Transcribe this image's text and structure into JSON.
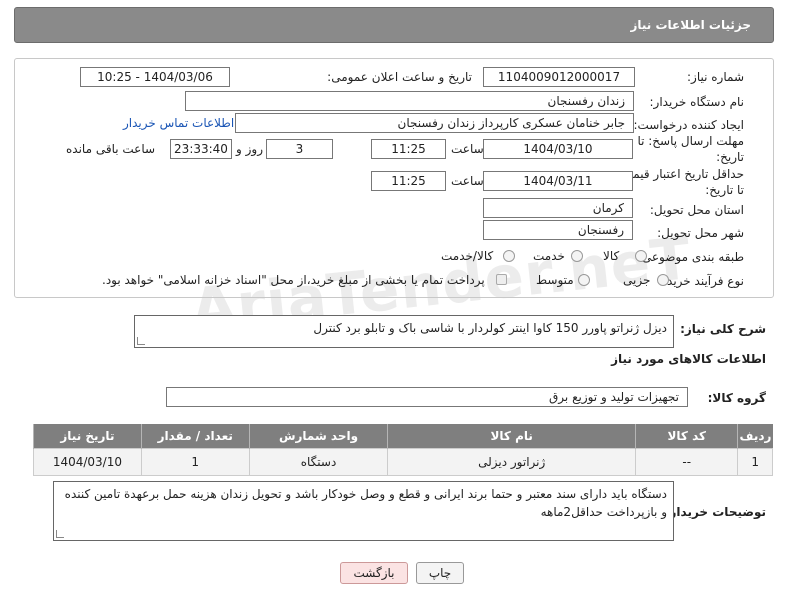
{
  "header": {
    "title": "جزئیات اطلاعات نیاز"
  },
  "form": {
    "need_number": {
      "label": "شماره نیاز:",
      "value": "1104009012000017"
    },
    "announce_datetime": {
      "label": "تاریخ و ساعت اعلان عمومی:",
      "value": "1404/03/06 - 10:25"
    },
    "buyer_org": {
      "label": "نام دستگاه خریدار:",
      "value": "زندان رفسنجان"
    },
    "requester": {
      "label": "ایجاد کننده درخواست:",
      "value": "جابر خنامان عسکری کارپرداز زندان رفسنجان",
      "contact_link": "اطلاعات تماس خریدار"
    },
    "reply_deadline": {
      "label_line1": "مهلت ارسال پاسخ: تا",
      "label_line2": "تاریخ:",
      "date": "1404/03/10",
      "time_label": "ساعت",
      "time": "11:25",
      "days": "3",
      "days_label": "روز و",
      "remaining": "23:33:40",
      "remaining_label": "ساعت باقی مانده"
    },
    "price_validity": {
      "label_line1": "حداقل تاریخ اعتبار قیمت:",
      "label_line2": "تا تاریخ:",
      "date": "1404/03/11",
      "time_label": "ساعت",
      "time": "11:25"
    },
    "province": {
      "label": "استان محل تحویل:",
      "value": "کرمان"
    },
    "city": {
      "label": "شهر محل تحویل:",
      "value": "رفسنجان"
    },
    "category": {
      "label": "طبقه بندی موضوعی:",
      "options": [
        "کالا",
        "خدمت",
        "کالا/خدمت"
      ]
    },
    "process": {
      "label": "نوع فرآیند خرید :",
      "options": [
        "جزیی",
        "متوسط"
      ],
      "note": "پرداخت تمام یا بخشی از مبلغ خرید،از محل \"اسناد خزانه اسلامی\" خواهد بود."
    }
  },
  "description": {
    "label": "شرح کلی نیاز:",
    "value": "دیزل ژنراتو پاورر 150 کاوا اینتر کولردار با شاسی باک و تابلو برد کنترل"
  },
  "goods_section": {
    "title": "اطلاعات کالاهای مورد نیاز",
    "group_label": "گروه کالا:",
    "group_value": "تجهیزات تولید و توزیع برق"
  },
  "table": {
    "headers": [
      "ردیف",
      "کد کالا",
      "نام کالا",
      "واحد شمارش",
      "تعداد / مقدار",
      "تاریخ نیاز"
    ],
    "rows": [
      [
        "1",
        "--",
        "ژنراتور دیزلی",
        "دستگاه",
        "1",
        "1404/03/10"
      ]
    ]
  },
  "buyer_notes": {
    "label": "توضیحات خریدار:",
    "value": "دستگاه باید دارای سند معتبر و حتما برند ایرانی و قطع و وصل خودکار باشد و تحویل زندان هزینه حمل برعهدة تامین کننده و بازپرداخت حداقل2ماهه"
  },
  "buttons": {
    "print": "چاپ",
    "back": "بازگشت"
  },
  "watermark": "AriaTender.neT"
}
